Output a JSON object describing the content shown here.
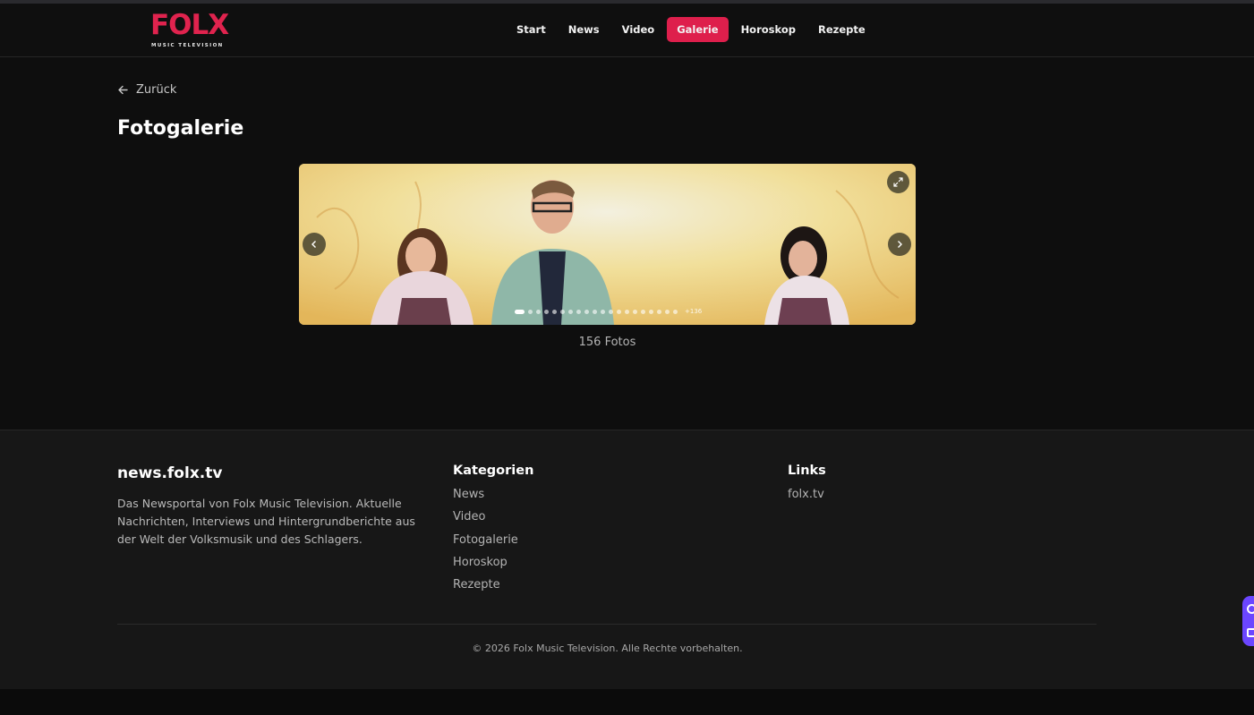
{
  "header": {
    "logo_text": "FOLX",
    "logo_subtitle": "MUSIC TELEVISION",
    "nav": [
      {
        "label": "Start",
        "active": false
      },
      {
        "label": "News",
        "active": false
      },
      {
        "label": "Video",
        "active": false
      },
      {
        "label": "Galerie",
        "active": true
      },
      {
        "label": "Horoskop",
        "active": false
      },
      {
        "label": "Rezepte",
        "active": false
      }
    ]
  },
  "main": {
    "back_label": "Zurück",
    "title": "Fotogalerie",
    "gallery": {
      "visible_dots": 20,
      "active_index": 0,
      "more_label": "+136",
      "count_label": "156 Fotos"
    }
  },
  "footer": {
    "brand": "news.folx.tv",
    "description": "Das Newsportal von Folx Music Television. Aktuelle Nachrichten, Interviews und Hintergrundberichte aus der Welt der Volksmusik und des Schlagers.",
    "categories": {
      "title": "Kategorien",
      "items": [
        "News",
        "Video",
        "Fotogalerie",
        "Horoskop",
        "Rezepte"
      ]
    },
    "links": {
      "title": "Links",
      "items": [
        "folx.tv"
      ]
    },
    "copyright": "© 2026 Folx Music Television. Alle Rechte vorbehalten."
  },
  "colors": {
    "accent": "#de1f4c",
    "background": "#0e0e0e",
    "footer_bg": "#171717"
  },
  "icons": [
    "arrow-left-icon",
    "chevron-left-icon",
    "chevron-right-icon",
    "expand-icon"
  ]
}
